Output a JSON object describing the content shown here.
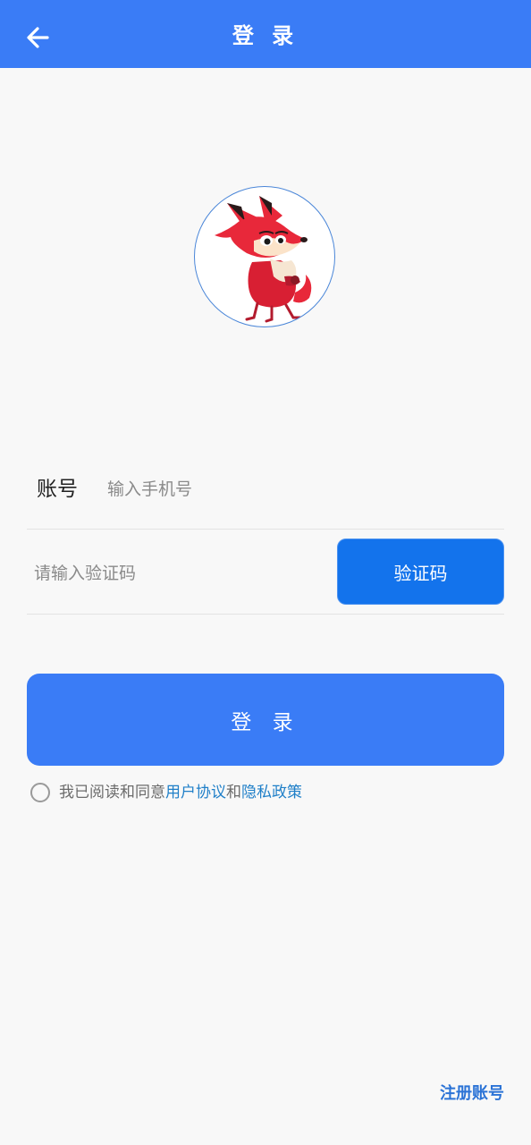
{
  "header": {
    "title": "登 录",
    "back_icon": "arrow-left-icon",
    "color": "#3a7cf6"
  },
  "avatar": {
    "icon": "fox-mascot-icon"
  },
  "account": {
    "label": "账号",
    "placeholder": "输入手机号",
    "value": ""
  },
  "code": {
    "placeholder": "请输入验证码",
    "value": "",
    "button_label": "验证码"
  },
  "login": {
    "button_label": "登 录"
  },
  "agreement": {
    "prefix": "我已阅读和同意",
    "user_agreement": "用户协议",
    "conjunction": "和",
    "privacy_policy": "隐私政策",
    "checked": false
  },
  "footer": {
    "register_label": "注册账号"
  }
}
